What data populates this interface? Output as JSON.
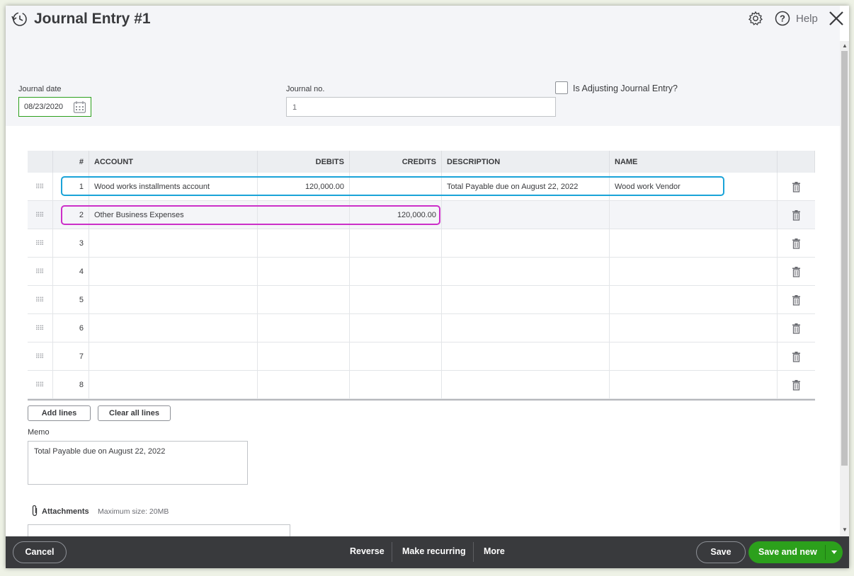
{
  "header": {
    "title": "Journal Entry #1",
    "help_label": "Help"
  },
  "form": {
    "date_label": "Journal date",
    "date_value": "08/23/2020",
    "journal_no_label": "Journal no.",
    "journal_no_value": "1",
    "adjusting_label": "Is Adjusting Journal Entry?",
    "adjusting_checked": false
  },
  "grid": {
    "columns": [
      "#",
      "ACCOUNT",
      "DEBITS",
      "CREDITS",
      "DESCRIPTION",
      "NAME"
    ],
    "rows": [
      {
        "num": "1",
        "account": "Wood works installments account",
        "debit": "120,000.00",
        "credit": "",
        "description": "Total Payable due on August 22, 2022",
        "name": "Wood work Vendor"
      },
      {
        "num": "2",
        "account": "Other Business Expenses",
        "debit": "",
        "credit": "120,000.00",
        "description": "",
        "name": ""
      },
      {
        "num": "3",
        "account": "",
        "debit": "",
        "credit": "",
        "description": "",
        "name": ""
      },
      {
        "num": "4",
        "account": "",
        "debit": "",
        "credit": "",
        "description": "",
        "name": ""
      },
      {
        "num": "5",
        "account": "",
        "debit": "",
        "credit": "",
        "description": "",
        "name": ""
      },
      {
        "num": "6",
        "account": "",
        "debit": "",
        "credit": "",
        "description": "",
        "name": ""
      },
      {
        "num": "7",
        "account": "",
        "debit": "",
        "credit": "",
        "description": "",
        "name": ""
      },
      {
        "num": "8",
        "account": "",
        "debit": "",
        "credit": "",
        "description": "",
        "name": ""
      }
    ],
    "add_lines_label": "Add lines",
    "clear_lines_label": "Clear all lines"
  },
  "memo": {
    "label": "Memo",
    "value": "Total Payable due on August 22, 2022"
  },
  "attachments": {
    "label": "Attachments",
    "max_size": "Maximum size: 20MB"
  },
  "footer": {
    "cancel_label": "Cancel",
    "reverse_label": "Reverse",
    "recurring_label": "Make recurring",
    "more_label": "More",
    "save_label": "Save",
    "save_new_label": "Save and new"
  },
  "colors": {
    "accent_green": "#2ca01c",
    "highlight_blue": "#1aa3d8",
    "highlight_pink": "#cc2fc8",
    "footer_bg": "#393a3d"
  }
}
